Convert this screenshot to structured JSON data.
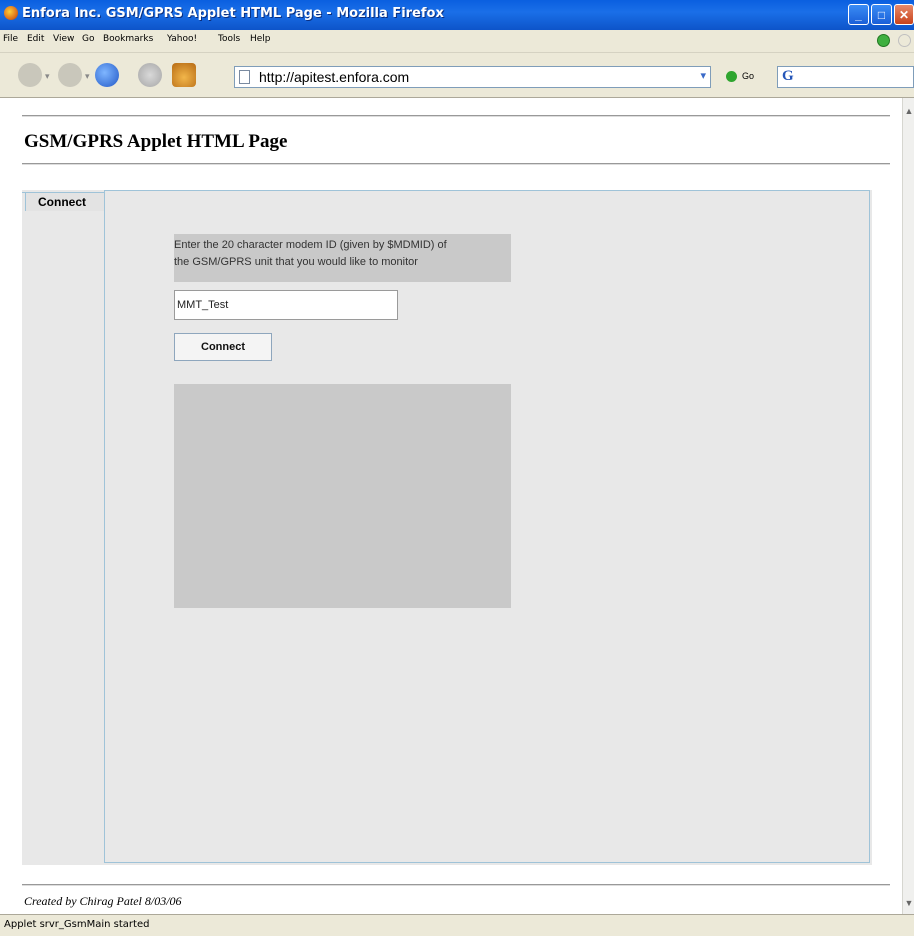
{
  "window": {
    "title": "Enfora Inc. GSM/GPRS Applet HTML Page - Mozilla Firefox",
    "minimize": "_",
    "maximize": "□",
    "close": "✕"
  },
  "menu": [
    "File",
    "Edit",
    "View",
    "Go",
    "Bookmarks",
    "Yahoo!",
    "Tools",
    "Help"
  ],
  "toolbar": {
    "url": "http://apitest.enfora.com",
    "go_label": "Go",
    "search_logo": "G"
  },
  "page": {
    "title": "GSM/GPRS Applet HTML Page",
    "footer": "Created by Chirag Patel 8/03/06"
  },
  "applet": {
    "tab_label": "Connect",
    "instruction_line1": "Enter the 20 character modem ID (given by $MDMID) of",
    "instruction_line2": "the GSM/GPRS unit that you would like to monitor",
    "modem_id_value": "MMT_Test",
    "connect_button": "Connect"
  },
  "status": {
    "text": "Applet srvr_GsmMain started"
  }
}
